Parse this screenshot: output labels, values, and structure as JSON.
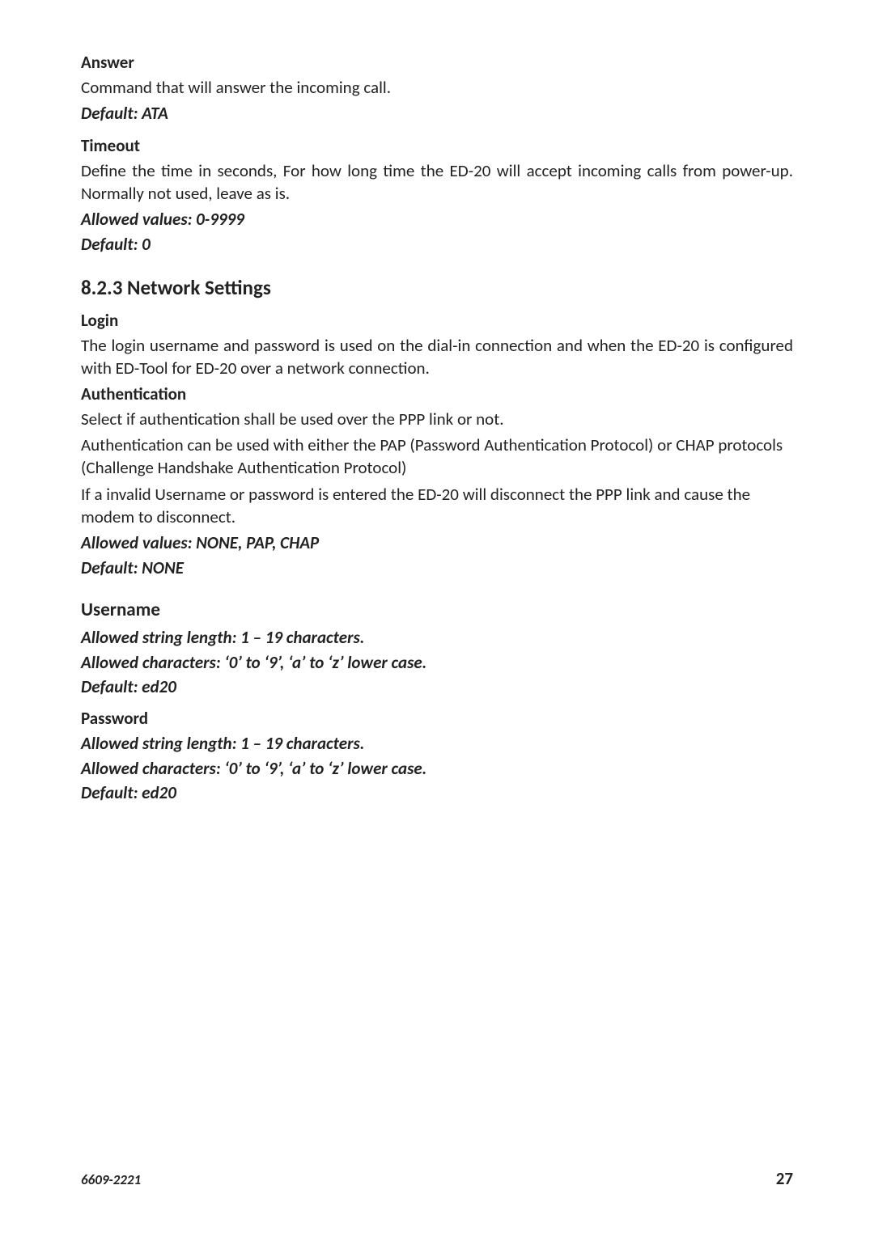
{
  "sections": {
    "answer": {
      "heading": "Answer",
      "desc": "Command that will answer the incoming call.",
      "default": "Default: ATA"
    },
    "timeout": {
      "heading": "Timeout",
      "desc": "Define the time in seconds, For how long time the ED-20 will accept incoming calls from power-up. Normally not used, leave as is.",
      "allowed": "Allowed values: 0-9999",
      "default": "Default: 0"
    },
    "network": {
      "heading": "8.2.3 Network Settings"
    },
    "login": {
      "heading": "Login",
      "desc": "The login username and password is used on the dial-in connection and when the ED-20 is configured with ED-Tool for ED-20 over a network connection."
    },
    "auth": {
      "heading": "Authentication",
      "line1": "Select if authentication shall be used over the PPP link or not.",
      "line2": "Authentication can be used with either the PAP (Password Authentication Protocol) or CHAP protocols (Challenge Handshake Authentication Protocol)",
      "line3": "If a invalid Username or password is entered the ED-20 will disconnect the PPP link and cause the modem to disconnect.",
      "allowed": "Allowed values: NONE, PAP, CHAP",
      "default": "Default: NONE"
    },
    "username": {
      "heading": "Username",
      "len": "Allowed string length: 1 – 19 characters.",
      "chars": "Allowed characters: ‘0’ to ‘9’, ‘a’ to ‘z’ lower case.",
      "default": "Default: ed20"
    },
    "password": {
      "heading": "Password",
      "len": "Allowed string length: 1 – 19 characters.",
      "chars": "Allowed characters: ‘0’ to ‘9’, ‘a’ to ‘z’ lower case.",
      "default": "Default: ed20"
    }
  },
  "footer": {
    "doc_id": "6609-2221",
    "page_no": "27"
  }
}
